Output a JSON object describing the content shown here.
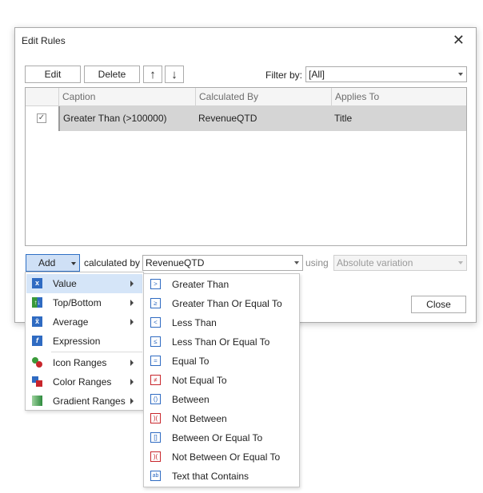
{
  "dialog": {
    "title": "Edit Rules",
    "toolbar": {
      "edit_label": "Edit",
      "delete_label": "Delete",
      "up_icon": "arrow-up-icon",
      "down_icon": "arrow-down-icon",
      "filter_label": "Filter by:",
      "filter_value": "[All]"
    },
    "grid": {
      "columns": [
        "Caption",
        "Calculated By",
        "Applies To"
      ],
      "rows": [
        {
          "checked": true,
          "caption": "Greater Than (>100000)",
          "calculated_by": "RevenueQTD",
          "applies_to": "Title"
        }
      ]
    },
    "bottom": {
      "add_label": "Add",
      "calculated_by_label": "calculated by",
      "calculated_by_value": "RevenueQTD",
      "using_label": "using",
      "using_value": "Absolute variation",
      "close_label": "Close"
    }
  },
  "add_menu": {
    "items": [
      {
        "label": "Value",
        "icon": "value-icon",
        "submenu": true,
        "highlighted": true
      },
      {
        "label": "Top/Bottom",
        "icon": "top-bottom-icon",
        "submenu": true
      },
      {
        "label": "Average",
        "icon": "average-icon",
        "submenu": true
      },
      {
        "label": "Expression",
        "icon": "expression-icon",
        "submenu": false
      },
      {
        "label": "Icon Ranges",
        "icon": "icon-ranges-icon",
        "submenu": true
      },
      {
        "label": "Color Ranges",
        "icon": "color-ranges-icon",
        "submenu": true
      },
      {
        "label": "Gradient Ranges",
        "icon": "gradient-ranges-icon",
        "submenu": true
      }
    ]
  },
  "value_submenu": {
    "items": [
      {
        "label": "Greater Than",
        "icon": "greater-than-icon",
        "glyph": ">"
      },
      {
        "label": "Greater Than Or Equal To",
        "icon": "greater-equal-icon",
        "glyph": "≥"
      },
      {
        "label": "Less Than",
        "icon": "less-than-icon",
        "glyph": "<"
      },
      {
        "label": "Less Than Or Equal To",
        "icon": "less-equal-icon",
        "glyph": "≤"
      },
      {
        "label": "Equal To",
        "icon": "equal-icon",
        "glyph": "="
      },
      {
        "label": "Not Equal To",
        "icon": "not-equal-icon",
        "glyph": "≠"
      },
      {
        "label": "Between",
        "icon": "between-icon",
        "glyph": "()"
      },
      {
        "label": "Not Between",
        "icon": "not-between-icon",
        "glyph": ")("
      },
      {
        "label": "Between Or Equal To",
        "icon": "between-equal-icon",
        "glyph": "[]"
      },
      {
        "label": "Not Between Or Equal To",
        "icon": "not-between-equal-icon",
        "glyph": ")("
      },
      {
        "label": "Text that Contains",
        "icon": "text-contains-icon",
        "glyph": "ab"
      }
    ]
  },
  "colors": {
    "accent": "#2f6bc2",
    "highlight": "#d5e5f8",
    "row_selected": "#d5d5d5",
    "danger": "#c8262c"
  }
}
